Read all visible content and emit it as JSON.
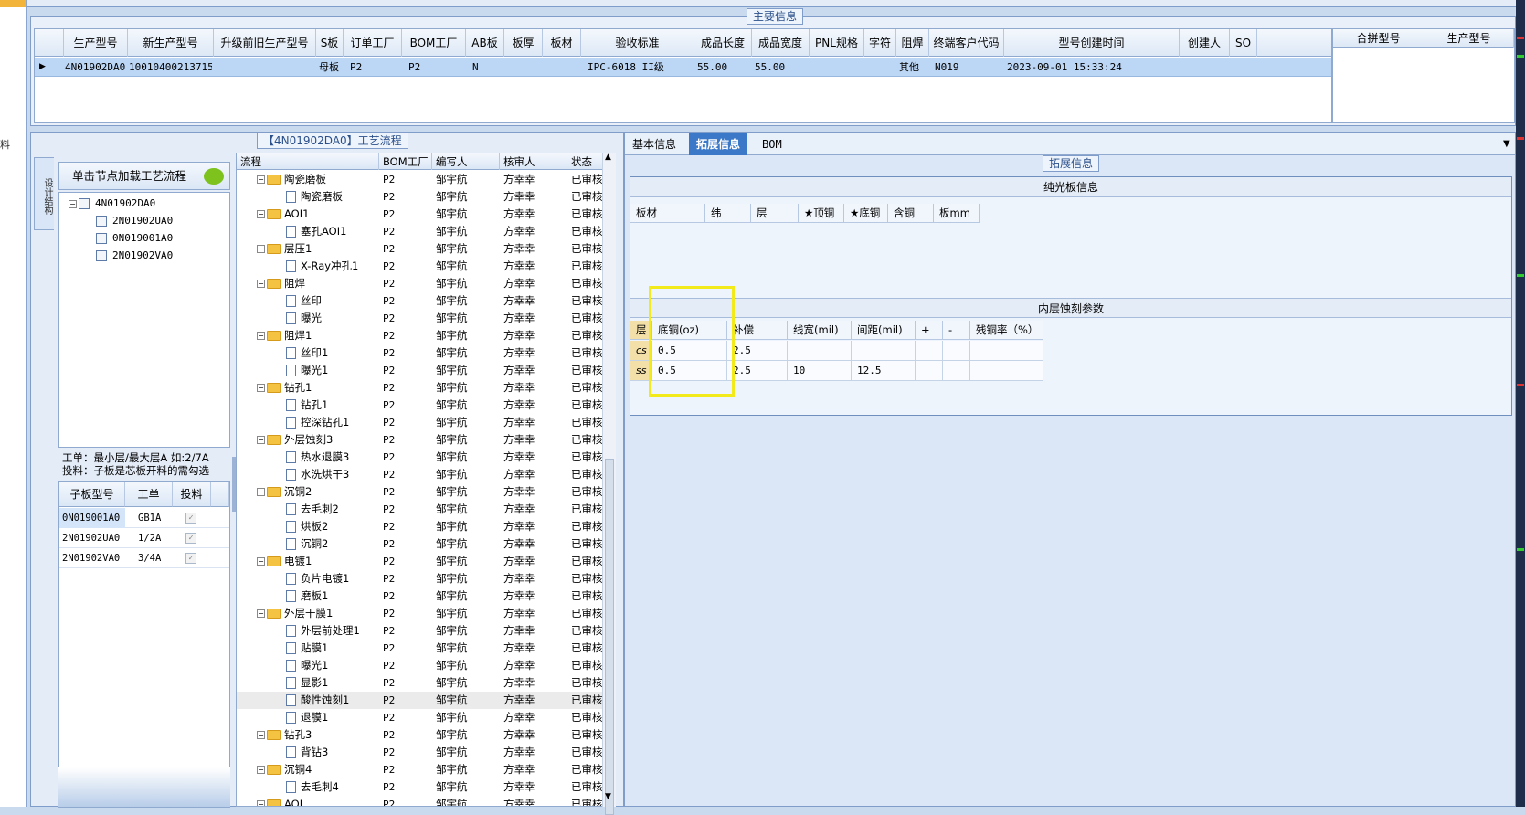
{
  "main_info": {
    "legend": "主要信息",
    "columns": [
      "生产型号",
      "新生产型号",
      "升级前旧生产型号",
      "S板",
      "订单工厂",
      "BOM工厂",
      "AB板",
      "板厚",
      "板材",
      "验收标准",
      "成品长度",
      "成品宽度",
      "PNL规格",
      "字符",
      "阻焊",
      "终端客户代码",
      "型号创建时间",
      "创建人",
      "SO"
    ],
    "row": {
      "生产型号": "4N01902DA0",
      "新生产型号": "10010400213715",
      "升级前旧生产型号": "",
      "S板": "母板",
      "订单工厂": "P2",
      "BOM工厂": "P2",
      "AB板": "N",
      "板厚": "",
      "板材": "",
      "验收标准": "IPC-6018 II级",
      "成品长度": "55.00",
      "成品宽度": "55.00",
      "PNL规格": "",
      "字符": "",
      "阻焊": "其他",
      "终端客户代码": "N019",
      "型号创建时间": "2023-09-01 15:33:24",
      "创建人": "",
      "SO": ""
    },
    "side_columns": [
      "合拼型号",
      "生产型号"
    ]
  },
  "process": {
    "legend": "【4N01902DA0】工艺流程",
    "vertical_tab": "设计结构",
    "load_hint": "单击节点加载工艺流程",
    "tree": [
      {
        "label": "4N01902DA0",
        "level": 0
      },
      {
        "label": "2N01902UA0",
        "level": 1
      },
      {
        "label": "0N019001A0",
        "level": 1
      },
      {
        "label": "2N01902VA0",
        "level": 1
      }
    ],
    "note_line1": "工单：最小层/最大层A 如:2/7A",
    "note_line2": "投料：子板是芯板开料的需勾选",
    "sub_columns": [
      "子板型号",
      "工单",
      "投料"
    ],
    "sub_rows": [
      {
        "model": "0N019001A0",
        "order": "GB1A"
      },
      {
        "model": "2N01902UA0",
        "order": "1/2A"
      },
      {
        "model": "2N01902VA0",
        "order": "3/4A"
      }
    ],
    "columns": [
      "流程",
      "BOM工厂",
      "编写人",
      "核审人",
      "状态"
    ],
    "rows": [
      {
        "name": "陶瓷磨板",
        "folder": true,
        "bom": "P2",
        "writer": "邹宇航",
        "reviewer": "方幸幸",
        "status": "已审核"
      },
      {
        "name": "陶瓷磨板",
        "folder": false,
        "bom": "P2",
        "writer": "邹宇航",
        "reviewer": "方幸幸",
        "status": "已审核"
      },
      {
        "name": "AOI1",
        "folder": true,
        "bom": "P2",
        "writer": "邹宇航",
        "reviewer": "方幸幸",
        "status": "已审核"
      },
      {
        "name": "塞孔AOI1",
        "folder": false,
        "bom": "P2",
        "writer": "邹宇航",
        "reviewer": "方幸幸",
        "status": "已审核"
      },
      {
        "name": "层压1",
        "folder": true,
        "bom": "P2",
        "writer": "邹宇航",
        "reviewer": "方幸幸",
        "status": "已审核"
      },
      {
        "name": "X-Ray冲孔1",
        "folder": false,
        "bom": "P2",
        "writer": "邹宇航",
        "reviewer": "方幸幸",
        "status": "已审核"
      },
      {
        "name": "阻焊",
        "folder": true,
        "bom": "P2",
        "writer": "邹宇航",
        "reviewer": "方幸幸",
        "status": "已审核"
      },
      {
        "name": "丝印",
        "folder": false,
        "bom": "P2",
        "writer": "邹宇航",
        "reviewer": "方幸幸",
        "status": "已审核"
      },
      {
        "name": "曝光",
        "folder": false,
        "bom": "P2",
        "writer": "邹宇航",
        "reviewer": "方幸幸",
        "status": "已审核"
      },
      {
        "name": "阻焊1",
        "folder": true,
        "bom": "P2",
        "writer": "邹宇航",
        "reviewer": "方幸幸",
        "status": "已审核"
      },
      {
        "name": "丝印1",
        "folder": false,
        "bom": "P2",
        "writer": "邹宇航",
        "reviewer": "方幸幸",
        "status": "已审核"
      },
      {
        "name": "曝光1",
        "folder": false,
        "bom": "P2",
        "writer": "邹宇航",
        "reviewer": "方幸幸",
        "status": "已审核"
      },
      {
        "name": "钻孔1",
        "folder": true,
        "bom": "P2",
        "writer": "邹宇航",
        "reviewer": "方幸幸",
        "status": "已审核"
      },
      {
        "name": "钻孔1",
        "folder": false,
        "bom": "P2",
        "writer": "邹宇航",
        "reviewer": "方幸幸",
        "status": "已审核"
      },
      {
        "name": "控深钻孔1",
        "folder": false,
        "bom": "P2",
        "writer": "邹宇航",
        "reviewer": "方幸幸",
        "status": "已审核"
      },
      {
        "name": "外层蚀刻3",
        "folder": true,
        "bom": "P2",
        "writer": "邹宇航",
        "reviewer": "方幸幸",
        "status": "已审核"
      },
      {
        "name": "热水退膜3",
        "folder": false,
        "bom": "P2",
        "writer": "邹宇航",
        "reviewer": "方幸幸",
        "status": "已审核"
      },
      {
        "name": "水洗烘干3",
        "folder": false,
        "bom": "P2",
        "writer": "邹宇航",
        "reviewer": "方幸幸",
        "status": "已审核"
      },
      {
        "name": "沉铜2",
        "folder": true,
        "bom": "P2",
        "writer": "邹宇航",
        "reviewer": "方幸幸",
        "status": "已审核"
      },
      {
        "name": "去毛刺2",
        "folder": false,
        "bom": "P2",
        "writer": "邹宇航",
        "reviewer": "方幸幸",
        "status": "已审核"
      },
      {
        "name": "烘板2",
        "folder": false,
        "bom": "P2",
        "writer": "邹宇航",
        "reviewer": "方幸幸",
        "status": "已审核"
      },
      {
        "name": "沉铜2",
        "folder": false,
        "bom": "P2",
        "writer": "邹宇航",
        "reviewer": "方幸幸",
        "status": "已审核"
      },
      {
        "name": "电镀1",
        "folder": true,
        "bom": "P2",
        "writer": "邹宇航",
        "reviewer": "方幸幸",
        "status": "已审核"
      },
      {
        "name": "负片电镀1",
        "folder": false,
        "bom": "P2",
        "writer": "邹宇航",
        "reviewer": "方幸幸",
        "status": "已审核"
      },
      {
        "name": "磨板1",
        "folder": false,
        "bom": "P2",
        "writer": "邹宇航",
        "reviewer": "方幸幸",
        "status": "已审核"
      },
      {
        "name": "外层干膜1",
        "folder": true,
        "bom": "P2",
        "writer": "邹宇航",
        "reviewer": "方幸幸",
        "status": "已审核"
      },
      {
        "name": "外层前处理1",
        "folder": false,
        "bom": "P2",
        "writer": "邹宇航",
        "reviewer": "方幸幸",
        "status": "已审核"
      },
      {
        "name": "贴膜1",
        "folder": false,
        "bom": "P2",
        "writer": "邹宇航",
        "reviewer": "方幸幸",
        "status": "已审核"
      },
      {
        "name": "曝光1",
        "folder": false,
        "bom": "P2",
        "writer": "邹宇航",
        "reviewer": "方幸幸",
        "status": "已审核"
      },
      {
        "name": "显影1",
        "folder": false,
        "bom": "P2",
        "writer": "邹宇航",
        "reviewer": "方幸幸",
        "status": "已审核"
      },
      {
        "name": "酸性蚀刻1",
        "folder": false,
        "bom": "P2",
        "writer": "邹宇航",
        "reviewer": "方幸幸",
        "status": "已审核",
        "highlight": true
      },
      {
        "name": "退膜1",
        "folder": false,
        "bom": "P2",
        "writer": "邹宇航",
        "reviewer": "方幸幸",
        "status": "已审核"
      },
      {
        "name": "钻孔3",
        "folder": true,
        "bom": "P2",
        "writer": "邹宇航",
        "reviewer": "方幸幸",
        "status": "已审核"
      },
      {
        "name": "背钻3",
        "folder": false,
        "bom": "P2",
        "writer": "邹宇航",
        "reviewer": "方幸幸",
        "status": "已审核"
      },
      {
        "name": "沉铜4",
        "folder": true,
        "bom": "P2",
        "writer": "邹宇航",
        "reviewer": "方幸幸",
        "status": "已审核"
      },
      {
        "name": "去毛刺4",
        "folder": false,
        "bom": "P2",
        "writer": "邹宇航",
        "reviewer": "方幸幸",
        "status": "已审核"
      },
      {
        "name": "AOI",
        "folder": true,
        "bom": "P2",
        "writer": "邹宇航",
        "reviewer": "方幸幸",
        "status": "已审核"
      }
    ]
  },
  "tabs": [
    "基本信息",
    "拓展信息",
    "BOM"
  ],
  "active_tab": "拓展信息",
  "ext": {
    "legend": "拓展信息",
    "bare_title": "纯光板信息",
    "bare_columns": [
      "板材",
      "纬",
      "层",
      "★顶铜",
      "★底铜",
      "含铜",
      "板mm"
    ],
    "inner_title": "内层蚀刻参数",
    "inner_columns": [
      "层",
      "底铜(oz)",
      "补偿",
      "线宽(mil)",
      "间距(mil)",
      "+",
      "-",
      "残铜率（%）"
    ],
    "inner_rows": [
      {
        "layer": "cs",
        "base": "0.5",
        "comp": "2.5",
        "width": "",
        "space": "",
        "plus": "",
        "minus": "",
        "residual": ""
      },
      {
        "layer": "ss",
        "base": "0.5",
        "comp": "2.5",
        "width": "10",
        "space": "12.5",
        "plus": "",
        "minus": "",
        "residual": ""
      }
    ]
  },
  "left_strip_glyph": "料",
  "colors": {
    "selection": "#bcd6f5",
    "active_tab": "#3b78c7",
    "highlight_box": "#f2ea1a",
    "panel": "#dbe7f6"
  }
}
